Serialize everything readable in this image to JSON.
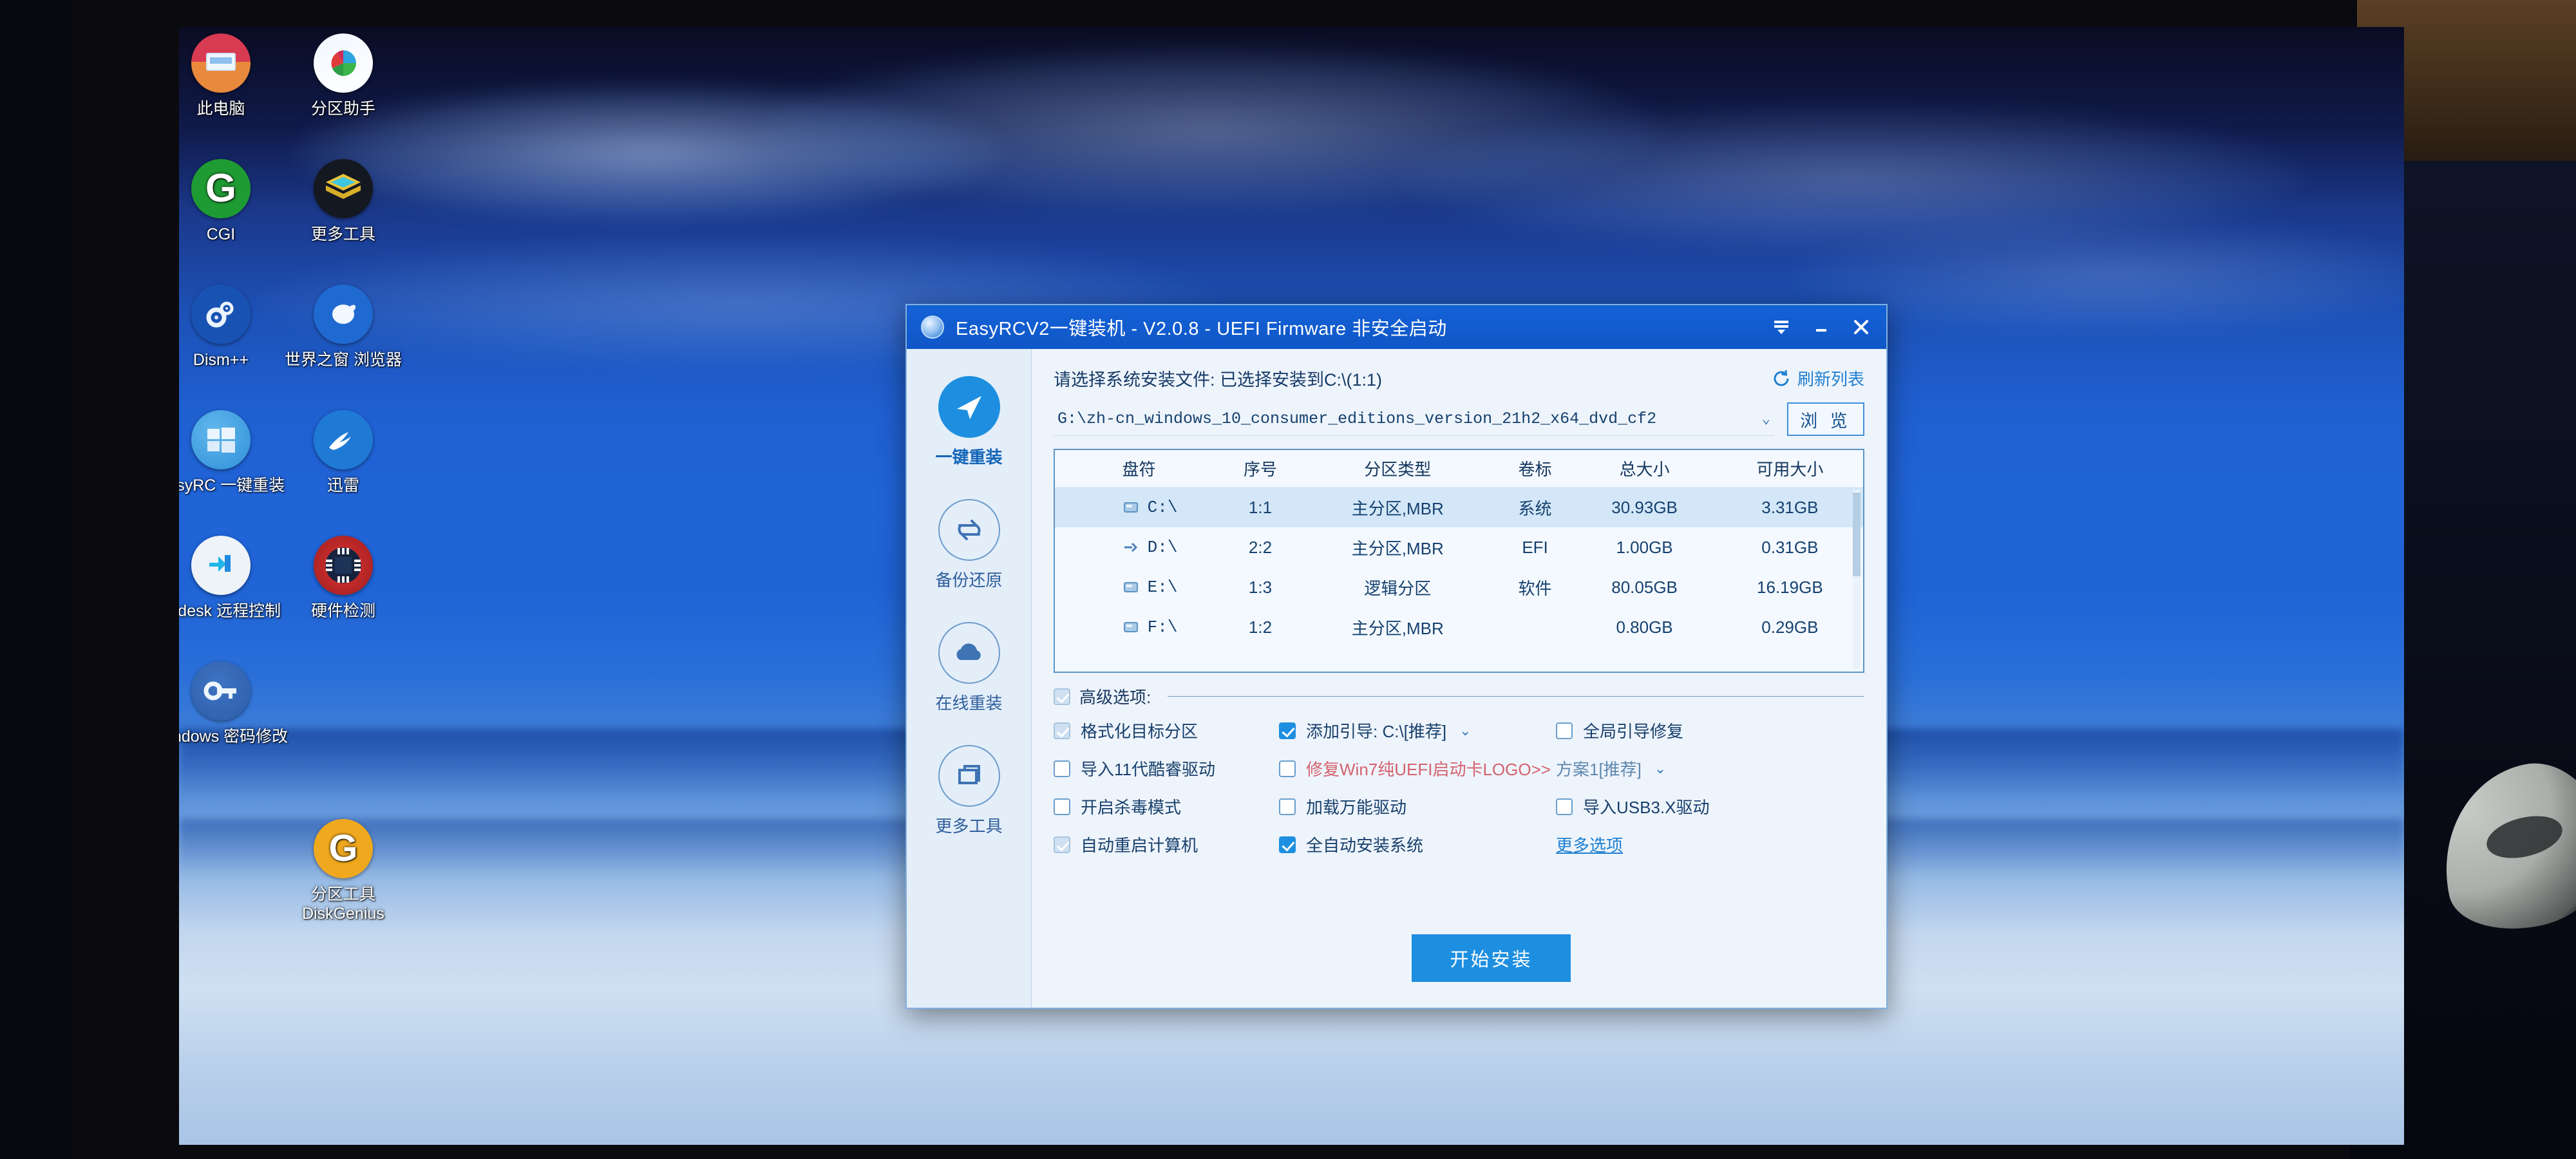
{
  "desktop": {
    "icons": [
      {
        "label": "此电脑",
        "icon": "this-pc-icon",
        "colors": [
          "#d83a52",
          "#e8893c"
        ]
      },
      {
        "label": "分区助手",
        "icon": "partition-assistant-icon",
        "colors": [
          "#f2f7ff",
          "#ffffff"
        ]
      },
      {
        "label": "CGI",
        "icon": "cgi-icon",
        "colors": [
          "#1f9b33",
          "#1f9b33"
        ]
      },
      {
        "label": "更多工具",
        "icon": "more-tools-icon",
        "colors": [
          "#141820",
          "#141820"
        ]
      },
      {
        "label": "Dism++",
        "icon": "dism-icon",
        "colors": [
          "#1853b4",
          "#1853b4"
        ]
      },
      {
        "label": "世界之窗 浏览器",
        "icon": "theworld-browser-icon",
        "colors": [
          "#1f6ad0",
          "#1f6ad0"
        ]
      },
      {
        "label": "EasyRC 一键重装",
        "icon": "easyrc-icon",
        "colors": [
          "#2f8fd8",
          "#2f8fd8"
        ]
      },
      {
        "label": "迅雷",
        "icon": "thunder-icon",
        "colors": [
          "#1f7ad6",
          "#1f7ad6"
        ]
      },
      {
        "label": "Todesk 远程控制",
        "icon": "todesk-icon",
        "colors": [
          "#eef3f8",
          "#eef3f8"
        ]
      },
      {
        "label": "硬件检测",
        "icon": "hardware-detect-icon",
        "colors": [
          "#c22a2a",
          "#c22a2a"
        ]
      },
      {
        "label": "Windows 密码修改",
        "icon": "windows-password-icon",
        "colors": [
          "#2a63b8",
          "#2a63b8"
        ]
      },
      {
        "label": "分区工具 DiskGenius",
        "icon": "diskgenius-icon",
        "colors": [
          "#f0a81e",
          "#f0a81e"
        ]
      }
    ]
  },
  "app": {
    "titlebar": {
      "title": "EasyRCV2一键装机 - V2.0.8 - UEFI Firmware 非安全启动",
      "logo_icon": "app-logo-icon",
      "menu_icon": "menu-collapse-icon",
      "minimize_icon": "minimize-icon",
      "close_icon": "close-icon",
      "menu_glyph": "▼",
      "minimize_glyph": "—",
      "close_glyph": "✕",
      "bg_color": "#1461d6"
    },
    "nav": {
      "items": [
        {
          "label": "一键重装",
          "icon": "cursor-arrow-icon",
          "glyph": "➤",
          "active": true
        },
        {
          "label": "备份还原",
          "icon": "backup-restore-icon",
          "glyph": "⇄",
          "active": false
        },
        {
          "label": "在线重装",
          "icon": "cloud-install-icon",
          "glyph": "☁",
          "active": false
        },
        {
          "label": "更多工具",
          "icon": "more-tools-icon",
          "glyph": "❐",
          "active": false
        }
      ]
    },
    "main": {
      "hint": "请选择系统安装文件: 已选择安装到C:\\(1:1)",
      "refresh_label": "刷新列表",
      "refresh_icon": "refresh-icon",
      "file_value": "G:\\zh-cn_windows_10_consumer_editions_version_21h2_x64_dvd_cf2",
      "file_caret": "⌄",
      "browse_label": "浏 览",
      "table": {
        "headers": [
          "盘符",
          "序号",
          "分区类型",
          "卷标",
          "总大小",
          "可用大小"
        ],
        "rows": [
          {
            "drive": "C:\\",
            "index": "1:1",
            "type": "主分区,MBR",
            "volume": "系统",
            "total": "30.93GB",
            "free": "3.31GB",
            "selected": true,
            "icon": "drive-icon"
          },
          {
            "drive": "D:\\",
            "index": "2:2",
            "type": "主分区,MBR",
            "volume": "EFI",
            "total": "1.00GB",
            "free": "0.31GB",
            "selected": false,
            "icon": "usb-drive-icon"
          },
          {
            "drive": "E:\\",
            "index": "1:3",
            "type": "逻辑分区",
            "volume": "软件",
            "total": "80.05GB",
            "free": "16.19GB",
            "selected": false,
            "icon": "drive-icon"
          },
          {
            "drive": "F:\\",
            "index": "1:2",
            "type": "主分区,MBR",
            "volume": "",
            "total": "0.80GB",
            "free": "0.29GB",
            "selected": false,
            "icon": "drive-icon"
          }
        ]
      },
      "advanced": {
        "label": "高级选项:",
        "checked": true,
        "options": [
          {
            "label": "格式化目标分区",
            "state": "dim",
            "name": "format-target-partition"
          },
          {
            "label": "添加引导: C:\\[推荐]",
            "state": "checked",
            "name": "add-boot-entry",
            "caret": "⌄"
          },
          {
            "label": "全局引导修复",
            "state": "unchecked",
            "name": "global-boot-repair"
          },
          {
            "label": "导入11代酷睿驱动",
            "state": "unchecked",
            "name": "import-11th-gen-driver"
          },
          {
            "label": "修复Win7纯UEFI启动卡LOGO>>",
            "state": "unchecked",
            "name": "fix-win7-uefi-logo",
            "style": "warn"
          },
          {
            "label": "方案1[推荐]",
            "state": "none",
            "name": "scheme-select",
            "caret": "⌄",
            "style": "muted"
          },
          {
            "label": "开启杀毒模式",
            "state": "unchecked",
            "name": "enable-antivirus-mode"
          },
          {
            "label": "加载万能驱动",
            "state": "unchecked",
            "name": "load-universal-driver"
          },
          {
            "label": "导入USB3.X驱动",
            "state": "unchecked",
            "name": "import-usb3-driver"
          },
          {
            "label": "自动重启计算机",
            "state": "dim",
            "name": "auto-reboot-computer"
          },
          {
            "label": "全自动安装系统",
            "state": "checked",
            "name": "fully-auto-install"
          },
          {
            "label": "更多选项",
            "state": "none",
            "name": "more-options-link",
            "style": "link"
          }
        ]
      },
      "install_label": "开始安装",
      "accent_color": "#1e8fe0"
    }
  }
}
